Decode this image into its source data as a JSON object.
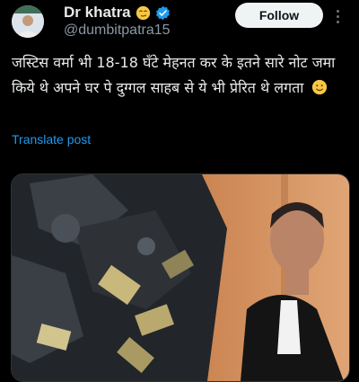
{
  "author": {
    "display_name": "Dr khatra",
    "handle": "@dumbitpatra15",
    "name_emoji": "smirking-face-icon",
    "verified_badge": "verified-badge-icon",
    "avatar": "avatar-photo"
  },
  "actions": {
    "follow_label": "Follow",
    "more_icon": "more-options-icon"
  },
  "post": {
    "text": "जस्टिस वर्मा भी 18-18 घँटे मेहनत कर के इतने सारे नोट जमा किये थे अपने घर पे दुग्गल साहब से ये भी प्रेरित थे लगता",
    "trailing_emoji": "smiling-face-icon",
    "translate_label": "Translate post"
  },
  "media": {
    "left_image": "burnt-currency-notes-photo",
    "right_image": "man-in-judicial-robes-photo"
  },
  "colors": {
    "background": "#000000",
    "text_primary": "#e7e9ea",
    "text_secondary": "#8b98a5",
    "link_blue": "#1d9bf0",
    "verified_blue": "#1d9bf0",
    "follow_bg": "#eff3f4"
  }
}
